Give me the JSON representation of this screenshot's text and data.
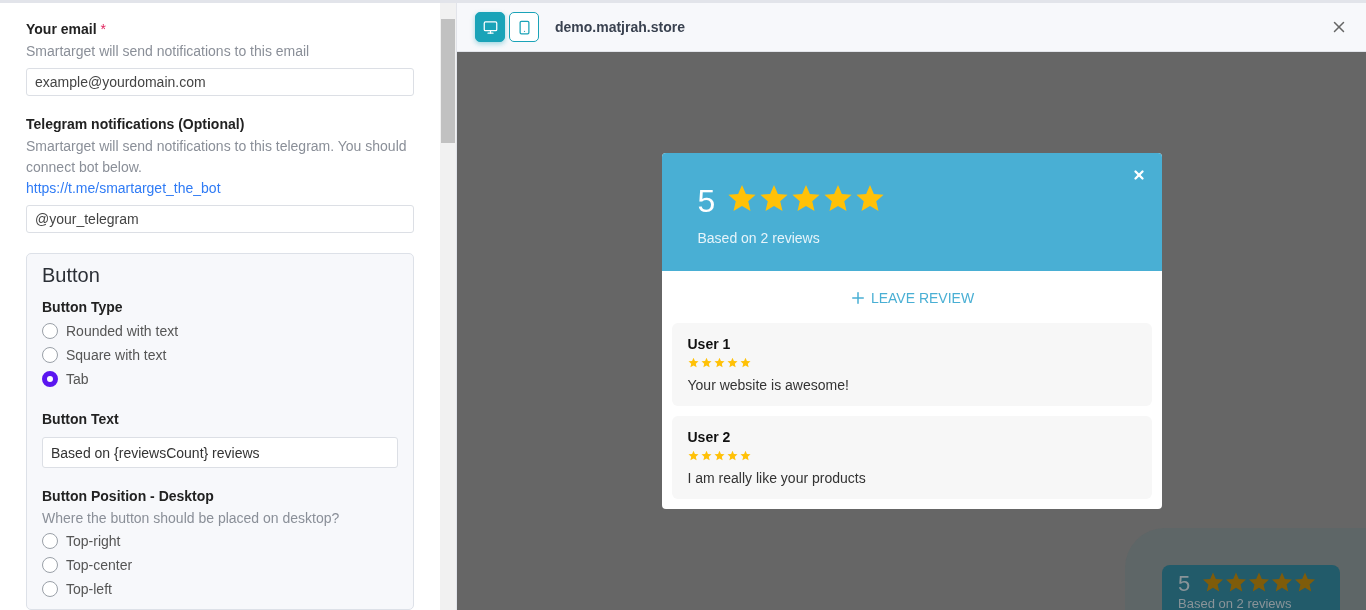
{
  "email": {
    "label": "Your email",
    "required_mark": "*",
    "hint": "Smartarget will send notifications to this email",
    "placeholder": "example@yourdomain.com"
  },
  "telegram": {
    "label": "Telegram notifications (Optional)",
    "hint": "Smartarget will send notifications to this telegram. You should connect bot below.",
    "link": "https://t.me/smartarget_the_bot",
    "placeholder": "@your_telegram"
  },
  "button_section": {
    "title": "Button",
    "button_type": {
      "label": "Button Type",
      "options": [
        {
          "label": "Rounded with text",
          "selected": false
        },
        {
          "label": "Square with text",
          "selected": false
        },
        {
          "label": "Tab",
          "selected": true
        }
      ]
    },
    "button_text": {
      "label": "Button Text",
      "value": "Based on {reviewsCount} reviews"
    },
    "position_desktop": {
      "label": "Button Position - Desktop",
      "hint": "Where the button should be placed on desktop?",
      "options": [
        {
          "label": "Top-right",
          "selected": false
        },
        {
          "label": "Top-center",
          "selected": false
        },
        {
          "label": "Top-left",
          "selected": false
        }
      ]
    }
  },
  "preview": {
    "devices": [
      {
        "kind": "desktop",
        "selected": true
      },
      {
        "kind": "mobile",
        "selected": false
      }
    ],
    "domain": "demo.matjrah.store"
  },
  "widget": {
    "score": "5",
    "stars": 5,
    "summary": "Based on 2 reviews",
    "leave_review": "LEAVE REVIEW",
    "reviews": [
      {
        "name": "User 1",
        "stars": 5,
        "text": "Your website is awesome!"
      },
      {
        "name": "User 2",
        "stars": 5,
        "text": "I am really like your products"
      }
    ]
  },
  "tab_button": {
    "score": "5",
    "stars": 5,
    "text": "Based on 2 reviews"
  }
}
